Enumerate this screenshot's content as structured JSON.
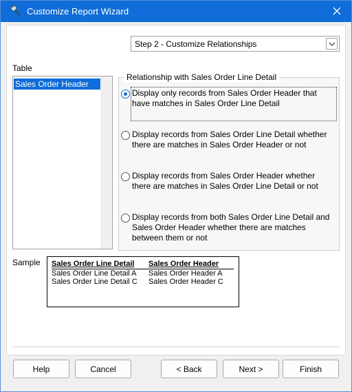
{
  "window": {
    "title": "Customize Report Wizard"
  },
  "step_select": {
    "value": "Step 2 - Customize Relationships"
  },
  "table": {
    "label": "Table",
    "items": [
      "Sales Order Header"
    ]
  },
  "relationship": {
    "legend": "Relationship with Sales Order Line Detail",
    "options": [
      {
        "label": "Display only records from Sales Order Header that have matches in Sales Order Line Detail",
        "selected": true
      },
      {
        "label": "Display records from Sales Order Line Detail whether there are matches in Sales Order Header or not",
        "selected": false
      },
      {
        "label": "Display records from Sales Order Header whether there are matches in Sales Order Line Detail or not",
        "selected": false
      },
      {
        "label": "Display records from both Sales Order Line Detail and Sales Order Header whether there are matches between them or not",
        "selected": false
      }
    ]
  },
  "sample": {
    "label": "Sample",
    "columns": [
      {
        "header": "Sales Order Line Detail",
        "rows": [
          "Sales Order Line Detail A",
          "Sales Order Line Detail C"
        ]
      },
      {
        "header": "Sales Order Header",
        "rows": [
          "Sales Order Header A",
          "Sales Order Header C"
        ]
      }
    ]
  },
  "buttons": {
    "help": "Help",
    "cancel": "Cancel",
    "back": "< Back",
    "next": "Next >",
    "finish": "Finish"
  },
  "colors": {
    "titlebar": "#0f6cd8",
    "selection": "#0f6cd8"
  }
}
